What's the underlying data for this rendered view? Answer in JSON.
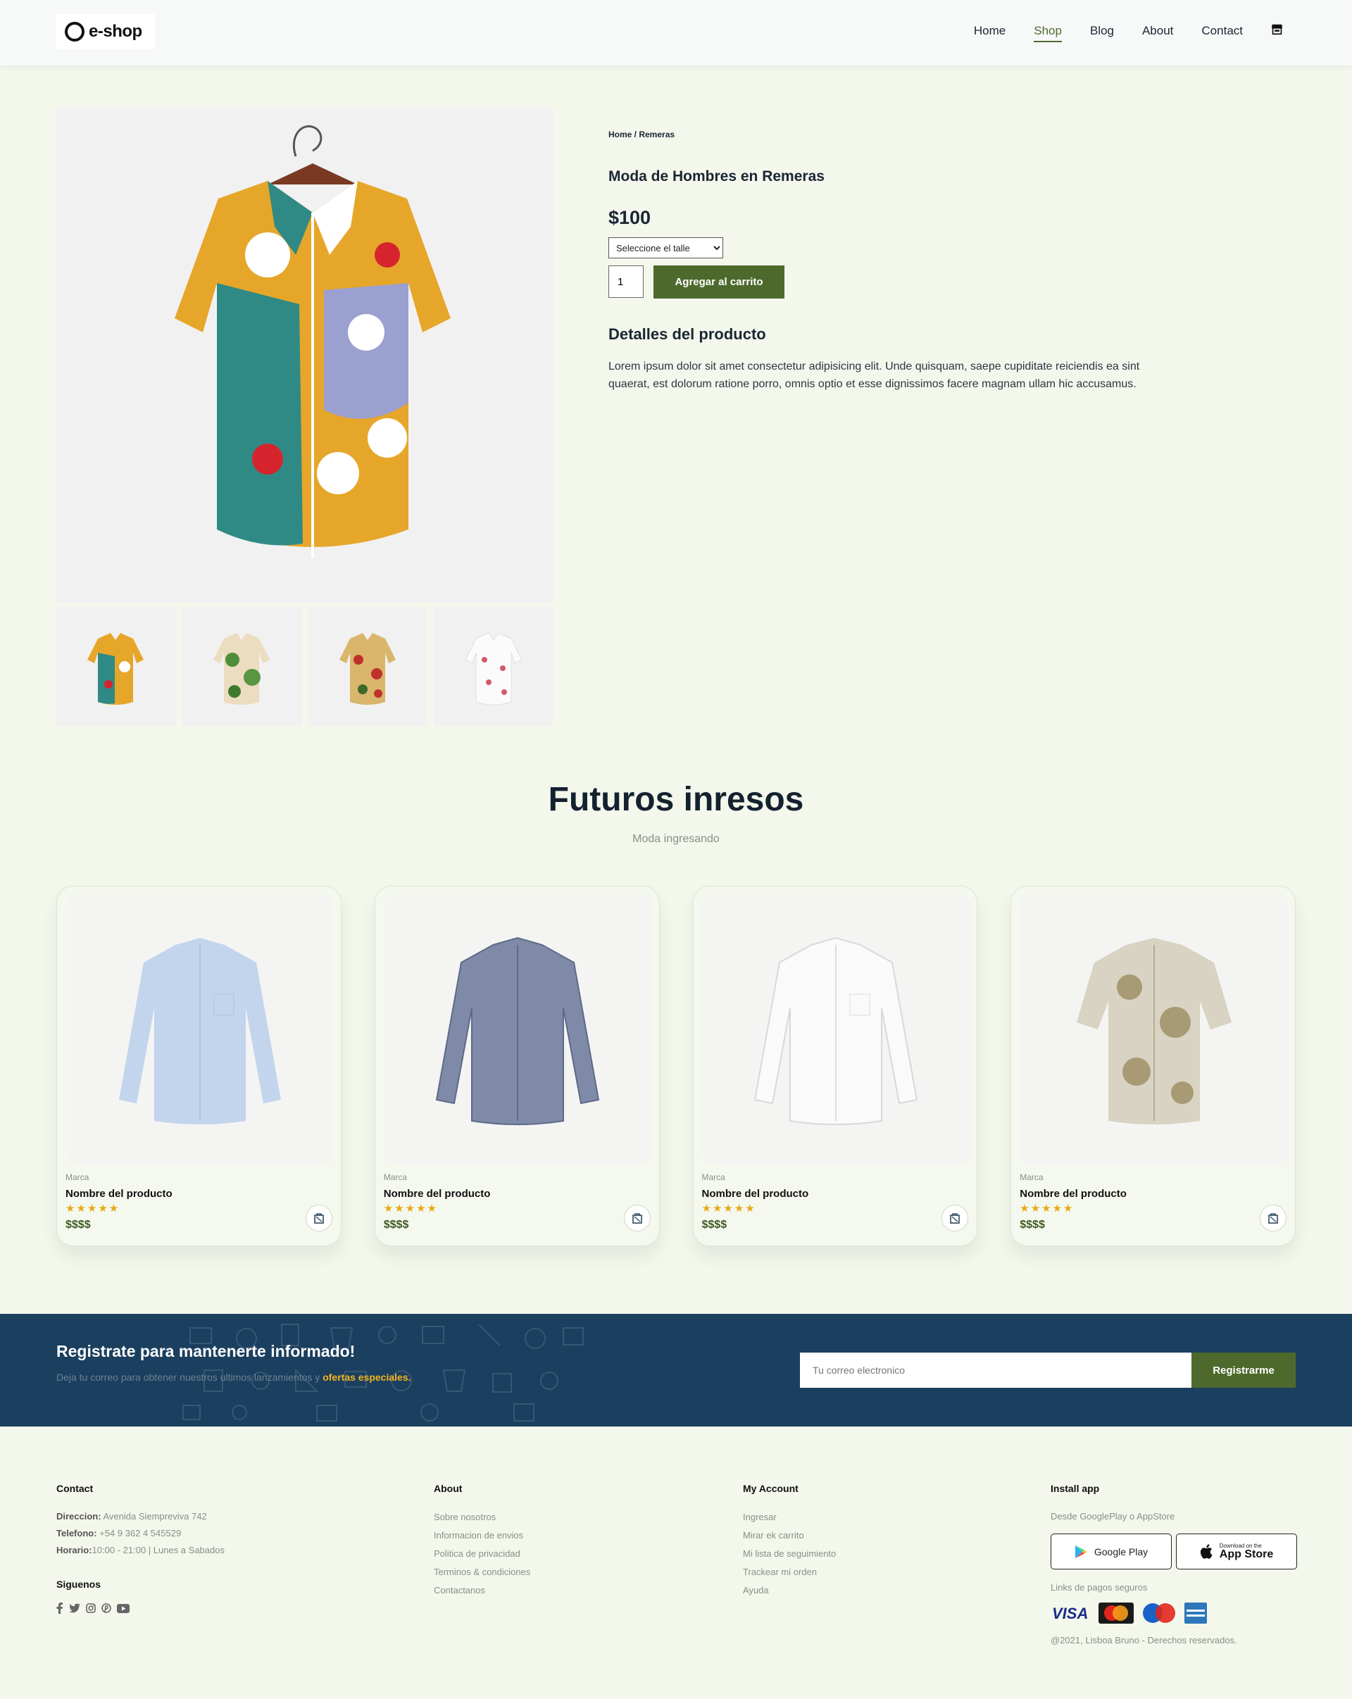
{
  "header": {
    "logo_text": "e-shop",
    "nav": [
      {
        "label": "Home"
      },
      {
        "label": "Shop"
      },
      {
        "label": "Blog"
      },
      {
        "label": "About"
      },
      {
        "label": "Contact"
      }
    ],
    "active": "Shop"
  },
  "product": {
    "breadcrumb": "Home / Remeras",
    "title": "Moda de Hombres en Remeras",
    "price": "$100",
    "size_select": "Seleccione el talle",
    "quantity": "1",
    "add_to_cart": "Agregar al carrito",
    "details_title": "Detalles del producto",
    "details_text": "Lorem ipsum dolor sit amet consectetur adipisicing elit. Unde quisquam, saepe cupiditate reiciendis ea sint quaerat, est dolorum ratione porro, omnis optio et esse dignissimos facere magnam ullam hic accusamus."
  },
  "upcoming": {
    "title": "Futuros inresos",
    "subtitle": "Moda ingresando",
    "cards": [
      {
        "brand": "Marca",
        "name": "Nombre del producto",
        "stars": "★★★★★",
        "price": "$$$$",
        "shirt": "light-blue"
      },
      {
        "brand": "Marca",
        "name": "Nombre del producto",
        "stars": "★★★★★",
        "price": "$$$$",
        "shirt": "gray-check"
      },
      {
        "brand": "Marca",
        "name": "Nombre del producto",
        "stars": "★★★★★",
        "price": "$$$$",
        "shirt": "white"
      },
      {
        "brand": "Marca",
        "name": "Nombre del producto",
        "stars": "★★★★★",
        "price": "$$$$",
        "shirt": "beige-print"
      }
    ]
  },
  "newsletter": {
    "title": "Registrate para mantenerte informado!",
    "subtitle": "Deja tu correo para obtener nuestros ultimos lanzamientos y",
    "highlight": "ofertas especiales.",
    "placeholder": "Tu correo electronico",
    "button": "Registrarme"
  },
  "footer": {
    "contact": {
      "title": "Contact",
      "address_label": "Direccion:",
      "address": "Avenida Siempreviva 742",
      "phone_label": "Telefono:",
      "phone": "+54 9 362 4 545529",
      "hours_label": "Horario:",
      "hours": "10:00 - 21:00 | Lunes a Sabados",
      "follow": "Siguenos"
    },
    "about": {
      "title": "About",
      "links": [
        "Sobre nosotros",
        "Informacion de envios",
        "Politica de privacidad",
        "Terminos & condiciones",
        "Contactanos"
      ]
    },
    "account": {
      "title": "My Account",
      "links": [
        "Ingresar",
        "Mirar ek carrito",
        "Mi lista de seguimiento",
        "Trackear mi orden",
        "Ayuda"
      ]
    },
    "app": {
      "title": "Install app",
      "subtitle": "Desde GooglePlay o AppStore",
      "google_play": "Google Play",
      "app_store_small": "Download on the",
      "app_store": "App Store",
      "payments_title": "Links de pagos seguros",
      "copyright": "@2021, Lisboa Bruno - Derechos reservados."
    }
  },
  "colors": {
    "accent": "#4d6a2c",
    "navy": "#1b3f5e",
    "background": "#f3f7ec",
    "highlight": "#f3b51d"
  }
}
